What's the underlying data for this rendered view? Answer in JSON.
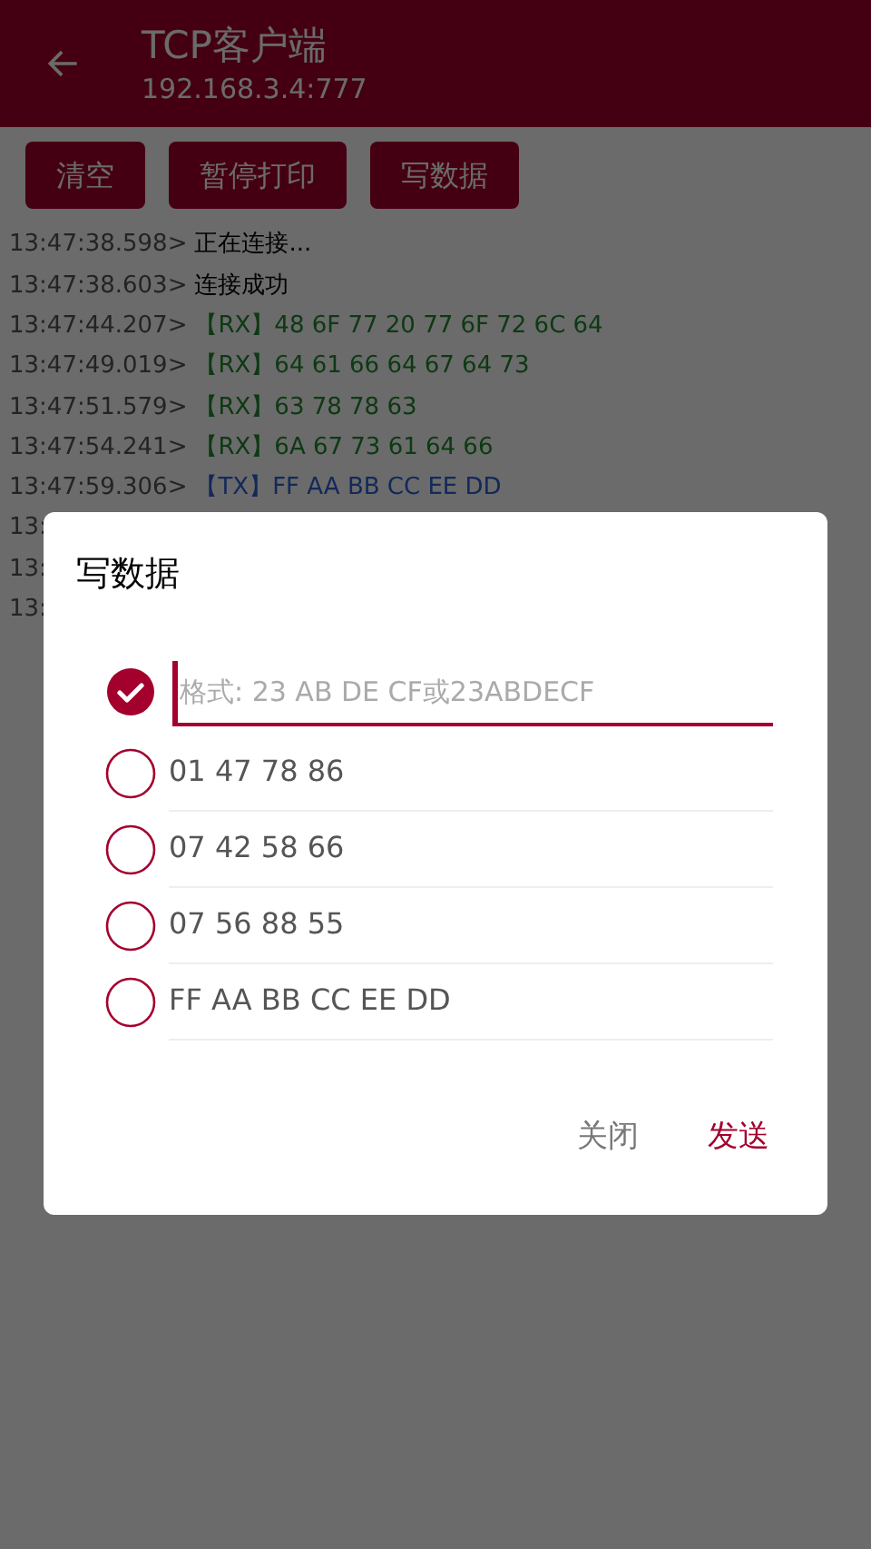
{
  "header": {
    "title": "TCP客户端",
    "subtitle": "192.168.3.4:777"
  },
  "toolbar": [
    "清空",
    "暂停打印",
    "写数据"
  ],
  "log": [
    {
      "time": "13:47:38.598>",
      "kind": "status",
      "message": "正在连接..."
    },
    {
      "time": "13:47:38.603>",
      "kind": "status",
      "message": "连接成功"
    },
    {
      "time": "13:47:44.207>",
      "kind": "rx",
      "message": "【RX】48 6F 77 20 77 6F 72 6C 64"
    },
    {
      "time": "13:47:49.019>",
      "kind": "rx",
      "message": "【RX】64 61 66 64 67 64 73"
    },
    {
      "time": "13:47:51.579>",
      "kind": "rx",
      "message": "【RX】63 78 78 63"
    },
    {
      "time": "13:47:54.241>",
      "kind": "rx",
      "message": "【RX】6A 67 73 61 64 66"
    },
    {
      "time": "13:47:59.306>",
      "kind": "tx",
      "message": "【TX】FF AA BB CC EE DD"
    },
    {
      "time": "13:"
    },
    {
      "time": "13:"
    },
    {
      "time": "13:"
    }
  ],
  "dialog": {
    "title": "写数据",
    "options": [
      {
        "kind": "input",
        "placeholder": "格式: 23 AB DE CF或23ABDECF",
        "selected": true
      },
      {
        "kind": "text",
        "label": "01 47 78 86",
        "selected": false
      },
      {
        "kind": "text",
        "label": "07 42 58 66",
        "selected": false
      },
      {
        "kind": "text",
        "label": "07 56 88 55",
        "selected": false
      },
      {
        "kind": "text",
        "label": "FF AA BB CC EE DD",
        "selected": false
      }
    ],
    "buttons": [
      {
        "label": "关闭",
        "kind": "secondary"
      },
      {
        "label": "发送",
        "kind": "primary"
      }
    ]
  }
}
